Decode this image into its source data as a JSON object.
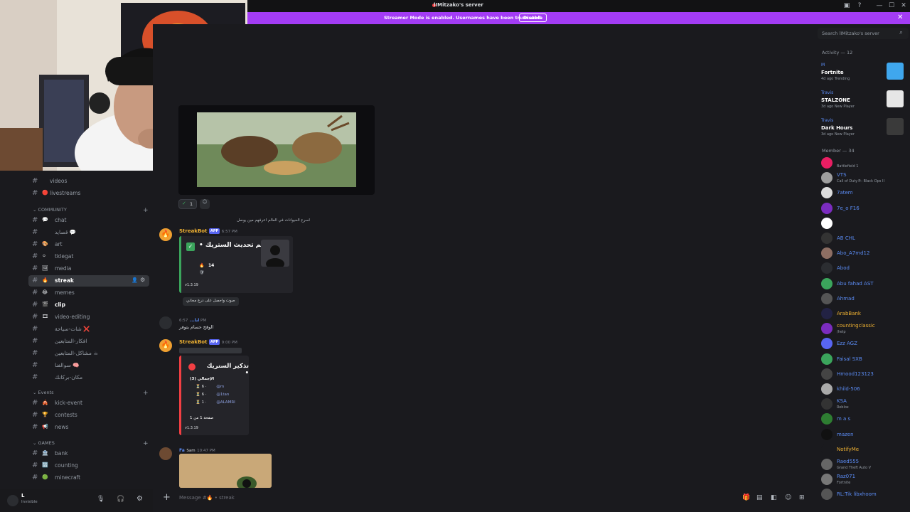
{
  "window": {
    "title": "lIMitzako's server",
    "controls": [
      "—",
      "☐",
      "✕"
    ]
  },
  "banner": {
    "text": "Streamer Mode is enabled. Usernames have been truncated.",
    "button": "Disable",
    "close": "✕"
  },
  "search": {
    "placeholder": "Search lIMitzako's server"
  },
  "sidebar": {
    "channels_top": [
      {
        "emoji": "",
        "label": "videos"
      },
      {
        "emoji": "🔴",
        "label": "livestreams"
      }
    ],
    "cat_community": "COMMUNITY",
    "community": [
      {
        "emoji": "💬",
        "label": "chat"
      },
      {
        "emoji": "",
        "label": "قصايد 💬"
      },
      {
        "emoji": "🎨",
        "label": "art"
      },
      {
        "emoji": "⚪",
        "label": "tklegat"
      },
      {
        "emoji": "🖼",
        "label": "media"
      },
      {
        "emoji": "🔥",
        "label": "streak"
      },
      {
        "emoji": "😂",
        "label": "memes"
      },
      {
        "emoji": "🎬",
        "label": "clip"
      },
      {
        "emoji": "🎞",
        "label": "video-editing"
      },
      {
        "emoji": "",
        "label": "شات-سياحة ❌"
      },
      {
        "emoji": "",
        "label": "افكار-المتابعين"
      },
      {
        "emoji": "",
        "label": "مشاكل-المتابعين ☕"
      },
      {
        "emoji": "",
        "label": "سوالفنا 🧠"
      },
      {
        "emoji": "",
        "label": "مكان-بركانك"
      }
    ],
    "cat_events": "Events",
    "events": [
      {
        "emoji": "🎪",
        "label": "kick-event"
      },
      {
        "emoji": "🏆",
        "label": "contests"
      },
      {
        "emoji": "📢",
        "label": "news"
      }
    ],
    "cat_games": "GAMES",
    "games": [
      {
        "emoji": "🏦",
        "label": "bank"
      },
      {
        "emoji": "🔢",
        "label": "counting"
      },
      {
        "emoji": "🟢",
        "label": "minecraft"
      }
    ]
  },
  "user_panel": {
    "name": "L",
    "status": "Invisible"
  },
  "messages": {
    "reaction_count": "1",
    "reply1": "اسرع الحيوانات في العالم اعرفهم مين يوصل",
    "msg1_author": "StreakBot",
    "app_tag": "APP",
    "msg1_time": "6:57 PM",
    "embed1_title": "تم تحديث الستريك •",
    "embed1_count": "14",
    "embed1_version": "v1.3.19",
    "embed1_link": "صوت واحصل على درع مجاني",
    "msg2_author": "ابا...",
    "msg2_time": "6:57 PM",
    "msg2_text": "الوقح حسام يتوفر",
    "msg3_author": "StreakBot",
    "msg3_time": "9:00 PM",
    "embed2_title": "تذكير الستريك •",
    "embed2_subtitle": "الإجمالي (3)",
    "embed2_rows": [
      {
        "n": "6",
        "user": "@m"
      },
      {
        "n": "6",
        "user": "@1tan"
      },
      {
        "n": "1",
        "user": "@ALAMRI"
      }
    ],
    "embed2_footer": "صفحة 1 من 1",
    "embed2_version": "v1.3.19",
    "msg4_author": "Fa",
    "msg4_tag": "Sam",
    "msg4_time": "10:47 PM"
  },
  "composer": {
    "placeholder": "Message #🔥 • streak"
  },
  "members": {
    "activity_header": "Activity — 12",
    "activities": [
      {
        "who": "M",
        "game": "Fortnite",
        "meta": "4d ago  Trending",
        "color": "#3fa7ee"
      },
      {
        "who": "Travis",
        "game": "STALZONE",
        "meta": "3d ago  New Player",
        "color": "#e6e6e6"
      },
      {
        "who": "Travis",
        "game": "Dark Hours",
        "meta": "3d ago  New Player",
        "color": "#3a3a3a"
      }
    ],
    "member_header": "Member — 34",
    "list": [
      {
        "name": "",
        "status": "Battlefield 1",
        "color": "#5b8cf5",
        "av": "#e91e63"
      },
      {
        "name": "VTS",
        "status": "Call of Duty®: Black Ops II",
        "color": "#5b8cf5",
        "av": "#9e9e9e"
      },
      {
        "name": "7atem",
        "status": "",
        "color": "#5b8cf5",
        "av": "#dddddd"
      },
      {
        "name": "7e_o F16",
        "status": "",
        "color": "#5b8cf5",
        "av": "#7b2cbf"
      },
      {
        "name": "",
        "status": "",
        "color": "#5b8cf5",
        "av": "#ffffff"
      },
      {
        "name": "AB CHL",
        "status": "",
        "color": "#5b8cf5",
        "av": "#333333"
      },
      {
        "name": "Abo_A7md12",
        "status": "",
        "color": "#5b8cf5",
        "av": "#8d6e63"
      },
      {
        "name": "Abod",
        "status": "",
        "color": "#5b8cf5",
        "av": "#2b2d31"
      },
      {
        "name": "Abu fahad AST",
        "status": "",
        "color": "#5b8cf5",
        "av": "#3ba55c"
      },
      {
        "name": "Ahmad",
        "status": "",
        "color": "#5b8cf5",
        "av": "#555555"
      },
      {
        "name": "ArabBank",
        "status": "",
        "color": "#f0b232",
        "av": "#222244"
      },
      {
        "name": "countingclassic",
        "status": "/help",
        "color": "#f0b232",
        "av": "#7b2cbf"
      },
      {
        "name": "Ezz AGZ",
        "status": "",
        "color": "#5b8cf5",
        "av": "#5865f2"
      },
      {
        "name": "Faisal SXB",
        "status": "",
        "color": "#5b8cf5",
        "av": "#3ba55c"
      },
      {
        "name": "Hmood123123",
        "status": "",
        "color": "#5b8cf5",
        "av": "#444444"
      },
      {
        "name": "khild-506",
        "status": "",
        "color": "#5b8cf5",
        "av": "#aaaaaa"
      },
      {
        "name": "KSA",
        "status": "Roblox",
        "color": "#5b8cf5",
        "av": "#333333"
      },
      {
        "name": "m a s",
        "status": "",
        "color": "#5b8cf5",
        "av": "#2e7d32"
      },
      {
        "name": "mazen",
        "status": "",
        "color": "#5b8cf5",
        "av": "#111111"
      },
      {
        "name": "NotifyMe",
        "status": "",
        "color": "#f0b232",
        "av": "#1a1a1e"
      },
      {
        "name": "Raed555",
        "status": "Grand Theft Auto V",
        "color": "#5b8cf5",
        "av": "#666666"
      },
      {
        "name": "Raz071",
        "status": "Fortnite",
        "color": "#5b8cf5",
        "av": "#777777"
      },
      {
        "name": "RL:Tik libxhoom",
        "status": "",
        "color": "#5b8cf5",
        "av": "#555555"
      }
    ]
  }
}
